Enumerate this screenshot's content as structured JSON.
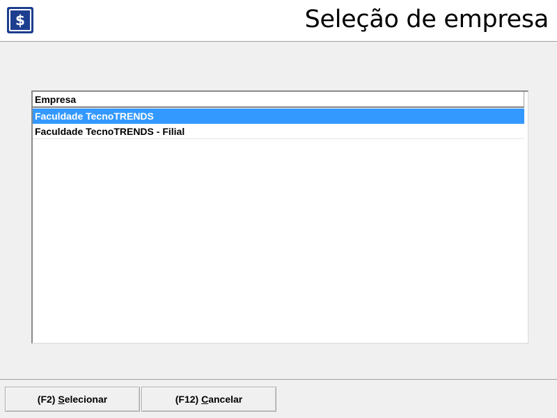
{
  "header": {
    "title": "Seleção de empresa",
    "logo_icon": "dollar-icon",
    "logo_glyph": "$",
    "brand_color": "#1d3e8e"
  },
  "list": {
    "column_header": "Empresa",
    "rows": [
      {
        "label": "Faculdade TecnoTRENDS",
        "selected": true
      },
      {
        "label": "Faculdade TecnoTRENDS - Filial",
        "selected": false
      }
    ],
    "selection_color": "#3399ff"
  },
  "footer": {
    "select_button": {
      "prefix": "(F2) ",
      "mnemonic": "S",
      "rest": "elecionar"
    },
    "cancel_button": {
      "prefix": "(F12) ",
      "mnemonic": "C",
      "rest": "ancelar"
    }
  }
}
